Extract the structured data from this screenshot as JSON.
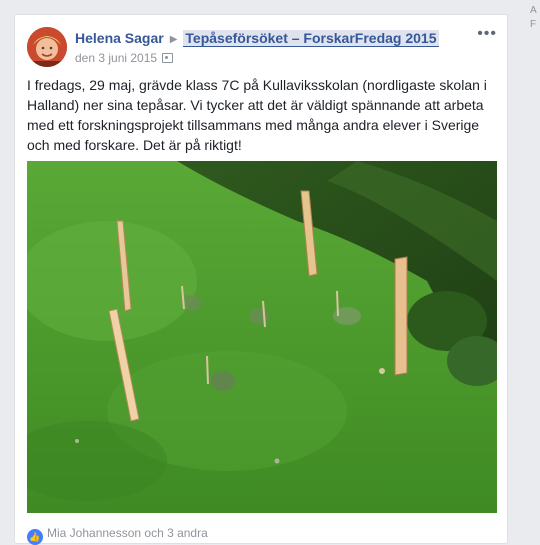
{
  "sidebar_edge": {
    "text": "A F"
  },
  "post": {
    "author": "Helena Sagar",
    "group": "Tepåseförsöket – ForskarFredag 2015",
    "date": "den 3 juni 2015",
    "audience_icon": "audience-icon",
    "more_icon": "more-options-icon",
    "text": "I fredags, 29 maj, grävde klass 7C på Kullaviksskolan (nordligaste skolan i Halland) ner sina tepåsar. Vi tycker att det är väldigt spännande att arbeta med ett forskningsprojekt tillsammans med många andra elever i Sverige och med forskare. Det är på riktigt!",
    "reactions": "Mia Johannesson och 3 andra"
  },
  "colors": {
    "link": "#365899",
    "meta": "#90949c",
    "body_text": "#1d2129",
    "background": "#e9ebee"
  }
}
